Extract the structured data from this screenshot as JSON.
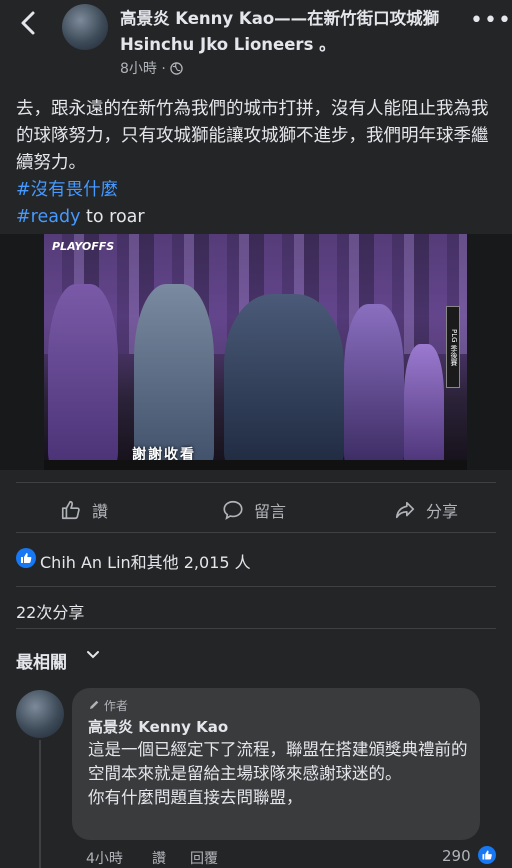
{
  "header": {
    "title": "高景炎 Kenny Kao——在新竹街口攻城獅 Hsinchu Jko Lioneers 。",
    "time": "8小時",
    "privacy_icon": "globe-icon"
  },
  "post": {
    "text": "去，跟永遠的在新竹為我們的城市打拼，沒有人能阻止我為我的球隊努力，只有攻城獅能讓攻城獅不進步，我們明年球季繼續努力。",
    "hashtag1": "#沒有畏什麼",
    "hashtag2_tag": "#ready",
    "hashtag2_rest": " to roar"
  },
  "media": {
    "logo": "PLAYOFFS",
    "side_text": "PLG 季後賽",
    "subtitle": "謝謝收看"
  },
  "actions": {
    "like": "讚",
    "comment": "留言",
    "share": "分享"
  },
  "reactions": {
    "text": "Chih An Lin和其他 2,015 人"
  },
  "shares": {
    "text": "22次分享"
  },
  "sort": {
    "label": "最相關"
  },
  "comment": {
    "badge": "作者",
    "name": "高景炎 Kenny Kao",
    "text": "這是一個已經定下了流程，聯盟在搭建頒獎典禮前的空間本來就是留給主場球隊來感謝球迷的。\n你有什麼問題直接去問聯盟，",
    "time": "4小時",
    "like": "讚",
    "reply": "回覆",
    "reaction_count": "290"
  },
  "colors": {
    "background": "#18191a",
    "card": "#242526",
    "bubble": "#3a3b3c",
    "link": "#4599ff",
    "brand": "#1877f2"
  }
}
